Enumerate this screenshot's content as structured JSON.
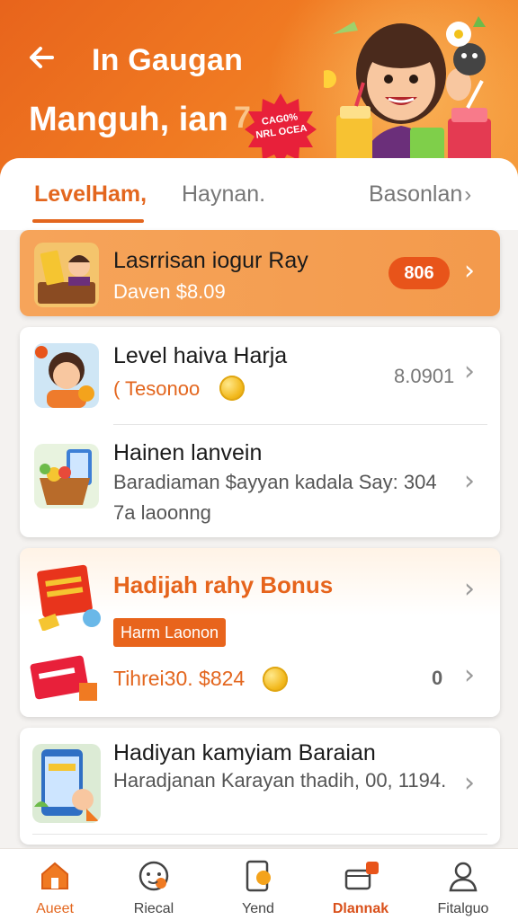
{
  "header": {
    "back_icon": "arrow-left-icon",
    "title": "In Gaugan",
    "subtitle": "Manguh, ian",
    "subtitle_suffix": "7",
    "badge_line1": "CAG0%",
    "badge_line2": "NRL OCEA",
    "mascot": "smiling-woman-with-drinks-illustration"
  },
  "tabs": [
    {
      "label": "LevelHam,",
      "active": true
    },
    {
      "label": "Haynan.",
      "active": false
    },
    {
      "label": "Basonlan",
      "active": false
    }
  ],
  "featured": {
    "title": "Lasrrisan iogur Ray",
    "subtitle": "Daven $8.09",
    "pill": "806",
    "icon": "coin-gift-box-icon"
  },
  "list1": [
    {
      "title": "Level haiva Harja",
      "subtitle": "( Tesonoo",
      "value": "8.0901",
      "icon": "avatar-coin-icon"
    },
    {
      "title": "Hainen lanvein",
      "subtitle": "Baradiaman $ayyan kadala Say: 304",
      "subtitle2": "7a laoonng",
      "icon": "fruit-basket-phone-icon"
    }
  ],
  "bonus": {
    "title": "Hadijah rahy Bonus",
    "tag": "Harm Laonon",
    "amount": "Tihrei30. $824",
    "count": "0",
    "icon_top": "red-gift-ticket-icon",
    "icon_bottom": "red-coupon-icon"
  },
  "list2": [
    {
      "title": "Hadiyan kamyiam Baraian",
      "subtitle": "Haradjanan Karayan thadih, 00, 1194.",
      "icon": "phone-shopping-icon"
    }
  ],
  "bottom_nav": [
    {
      "label": "Aueet",
      "icon": "home-icon",
      "active": true
    },
    {
      "label": "Riecal",
      "icon": "face-icon",
      "active": false
    },
    {
      "label": "Yend",
      "icon": "phone-coin-icon",
      "active": false
    },
    {
      "label": "Dlannak",
      "icon": "cart-box-icon",
      "active": false,
      "badge": "0"
    },
    {
      "label": "Fitalguo",
      "icon": "user-icon",
      "active": false
    }
  ],
  "colors": {
    "brand": "#e8641c",
    "accent": "#f39a4c",
    "pill": "#e8541a"
  }
}
